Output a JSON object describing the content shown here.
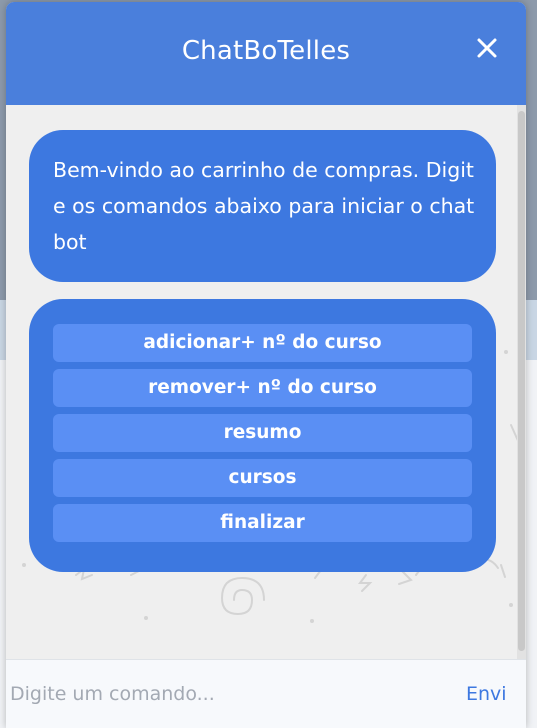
{
  "chat": {
    "title": "ChatBoTelles",
    "close_icon": "close-icon",
    "welcome_message": "Bem-vindo ao carrinho de compras. Digite os comandos abaixo para iniciar o chatbot",
    "commands": [
      {
        "label": "adicionar+ nº do curso"
      },
      {
        "label": "remover+ nº do curso"
      },
      {
        "label": "resumo"
      },
      {
        "label": "cursos"
      },
      {
        "label": "finalizar"
      }
    ],
    "input": {
      "placeholder": "Digite um comando...",
      "value": ""
    },
    "send_label": "Envi"
  },
  "colors": {
    "header": "#4a7fdc",
    "bubble": "#3d78e0",
    "command_button": "#5a8ff4",
    "chat_background": "#efefef",
    "send_text": "#3d78e0"
  }
}
